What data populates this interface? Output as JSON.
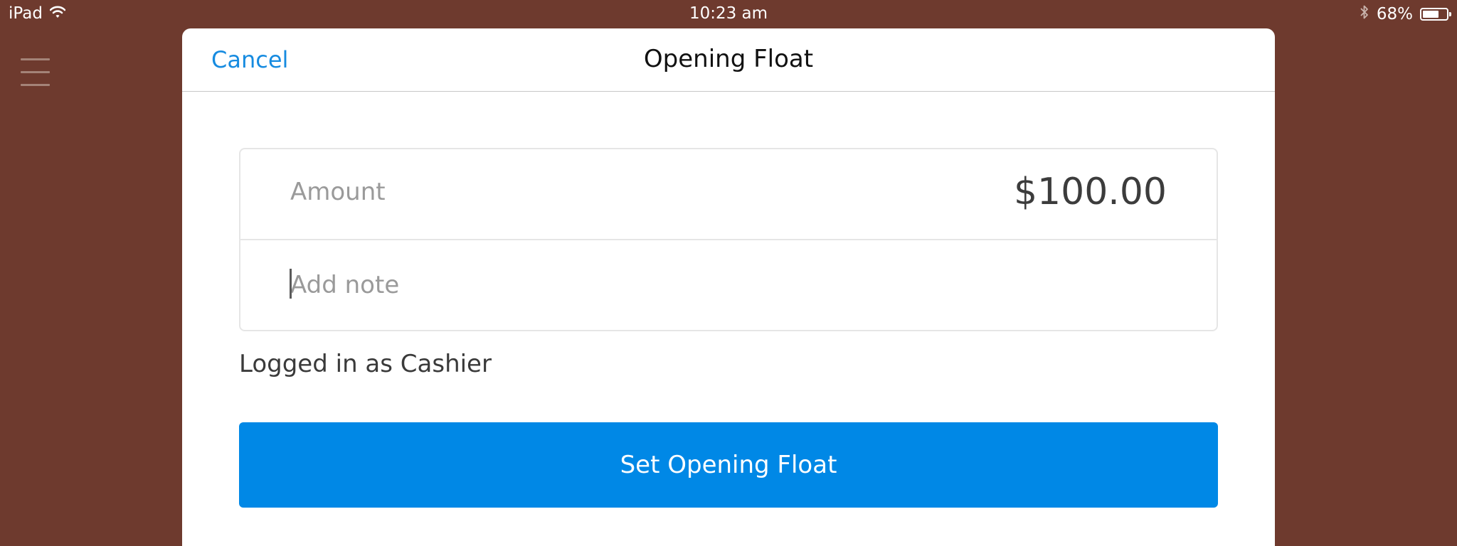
{
  "status_bar": {
    "device": "iPad",
    "time": "10:23 am",
    "battery_percent": "68%",
    "battery_level": 0.68,
    "icons": [
      "wifi-icon",
      "bluetooth-icon",
      "battery-icon"
    ]
  },
  "sidebar": {
    "menu_icon": "hamburger-menu-icon"
  },
  "modal": {
    "cancel_label": "Cancel",
    "title": "Opening Float",
    "amount_label": "Amount",
    "amount_value": "$100.00",
    "note_placeholder": "Add note",
    "note_value": "",
    "logged_in_text": "Logged in as Cashier",
    "submit_label": "Set Opening Float"
  },
  "colors": {
    "background": "#6e3a2e",
    "accent": "#0088e6",
    "link": "#168be0"
  }
}
